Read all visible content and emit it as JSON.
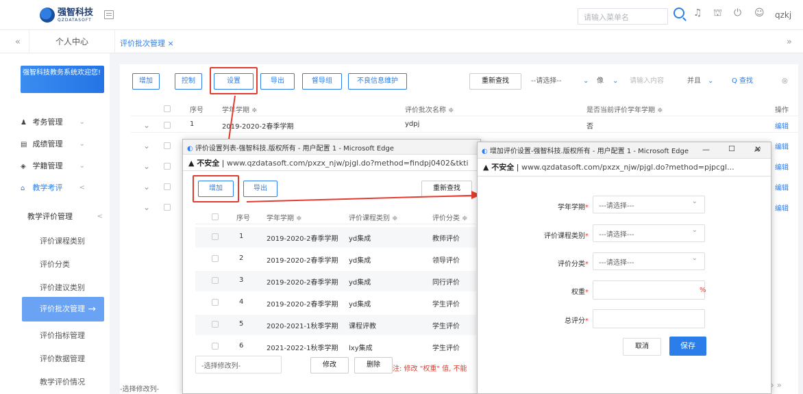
{
  "topbar": {
    "logo_name": "强智科技",
    "logo_sub": "QZDATASOFT",
    "search_placeholder": "请输入菜单名",
    "user_name": "qzkj"
  },
  "tabs": {
    "back": "«",
    "personal": "个人中心",
    "batch": "评价批次管理 ×",
    "forward": "»"
  },
  "sidebar": {
    "welcome": "强智科技教务系统欢迎您!",
    "items": [
      {
        "icon": "♟",
        "label": "考务管理",
        "arrow": "⌄"
      },
      {
        "icon": "▤",
        "label": "成绩管理",
        "arrow": "⌄"
      },
      {
        "icon": "◈",
        "label": "学籍管理",
        "arrow": "⌄"
      },
      {
        "icon": "⌂",
        "label": "教学考评",
        "arrow": "<"
      }
    ],
    "group": {
      "label": "教学评价管理",
      "arrow": "<"
    },
    "subitems": [
      "评价课程类别",
      "评价分类",
      "评价建议类别",
      "评价批次管理",
      "评价指标管理",
      "评价数据管理",
      "教学评价情况"
    ],
    "active_arrow": "→"
  },
  "toolbar": {
    "add": "增加",
    "control": "控制",
    "settings": "设置",
    "export": "导出",
    "supervisor_group": "督导组",
    "bad_info": "不良信息维护",
    "requery": "重新查找",
    "select_placeholder": "--请选择--",
    "like": "像",
    "content_placeholder": "请输入内容",
    "and": "并且",
    "search": "Q 查找"
  },
  "main_table": {
    "headers": [
      "序号",
      "学年学期 ≑",
      "评价批次名称 ≑",
      "是否当前评价学年学期 ≑",
      "操作"
    ],
    "row": {
      "no": "1",
      "term": "2019-2020-2春季学期",
      "name": "ydpj",
      "current": "否",
      "action": "编辑"
    },
    "actions": [
      "编辑",
      "编辑",
      "编辑",
      "编辑"
    ],
    "bottom_select": "-选择修改列-"
  },
  "popup1": {
    "title": "评价设置列表-强智科技.版权所有 - 用户配置 1 - Microsoft Edge",
    "insecure": "▲ 不安全",
    "url": "www.qzdatasoft.com/pxzx_njw/pjgl.do?method=findpj0402&tkti",
    "add": "增加",
    "export": "导出",
    "requery": "重新查找",
    "headers": [
      "序号",
      "学年学期 ≑",
      "评价课程类别 ≑",
      "评价分类 ≑"
    ],
    "rows": [
      {
        "no": "1",
        "term": "2019-2020-2春季学期",
        "cat": "yd集成",
        "cls": "教师评价"
      },
      {
        "no": "2",
        "term": "2019-2020-2春季学期",
        "cat": "yd集成",
        "cls": "领导评价"
      },
      {
        "no": "3",
        "term": "2019-2020-2春季学期",
        "cat": "yd集成",
        "cls": "同行评价"
      },
      {
        "no": "4",
        "term": "2019-2020-2春季学期",
        "cat": "yd集成",
        "cls": "学生评价"
      },
      {
        "no": "5",
        "term": "2020-2021-1秋季学期",
        "cat": "课程评教",
        "cls": "学生评价"
      },
      {
        "no": "6",
        "term": "2021-2022-1秋季学期",
        "cat": "lxy集成",
        "cls": "学生评价"
      }
    ],
    "select_col": "-选择修改列-",
    "modify": "修改",
    "delete": "删除",
    "note": "注: 修改 \"权重\" 值, 不能"
  },
  "popup2": {
    "title": "增加评价设置-强智科技.版权所有 - 用户配置 1 - Microsoft Edge",
    "insecure": "▲ 不安全",
    "url": "www.qzdatasoft.com/pxzx_njw/pjgl.do?method=pjpcgl...",
    "fields": {
      "term_label": "学年学期",
      "cat_label": "评价课程类别",
      "cls_label": "评价分类",
      "weight_label": "权重",
      "score_label": "总评分",
      "select_placeholder": "---请选择---",
      "percent": "%"
    },
    "cancel": "取消",
    "save": "保存"
  }
}
